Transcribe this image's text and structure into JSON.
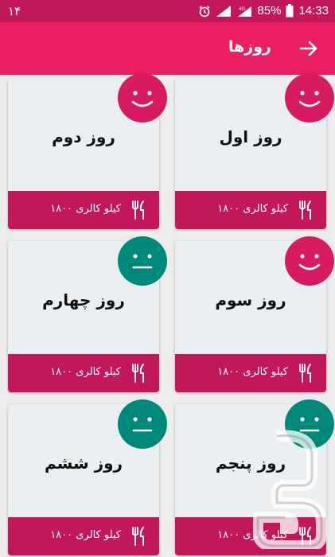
{
  "status_bar": {
    "left_text": "۱۴",
    "battery": "85%",
    "time": "14:33",
    "icons": [
      "alarm-icon",
      "signal-icon",
      "network-4g-icon",
      "battery-icon"
    ]
  },
  "app_bar": {
    "title": "روزها",
    "back_icon": "arrow-right-icon"
  },
  "colors": {
    "primary": "#e91e63",
    "primary_dark": "#c2185b",
    "happy_face": "#d81b60",
    "neutral_face": "#00897b",
    "card_bg": "#eceff1"
  },
  "days": [
    {
      "title": "روز اول",
      "calories": "۱۸۰۰ کیلو کالری",
      "mood": "happy"
    },
    {
      "title": "روز دوم",
      "calories": "۱۸۰۰ کیلو کالری",
      "mood": "happy"
    },
    {
      "title": "روز سوم",
      "calories": "۱۸۰۰ کیلو کالری",
      "mood": "happy"
    },
    {
      "title": "روز چهارم",
      "calories": "۱۸۰۰ کیلو کالری",
      "mood": "neutral"
    },
    {
      "title": "روز پنجم",
      "calories": "۱۸۰۰ کیلو کالری",
      "mood": "neutral"
    },
    {
      "title": "روز ششم",
      "calories": "۱۸۰۰ کیلو کالری",
      "mood": "neutral"
    }
  ]
}
